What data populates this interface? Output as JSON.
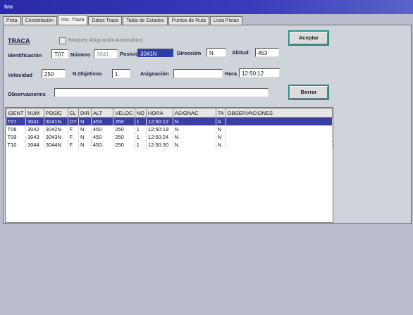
{
  "window": {
    "title": "tvu"
  },
  "tabs": [
    {
      "label": "Pista"
    },
    {
      "label": "Constelación"
    },
    {
      "label": "Inic. Traza"
    },
    {
      "label": "Datos Traza"
    },
    {
      "label": "Tabla de Estados"
    },
    {
      "label": "Puntos de Ruta"
    },
    {
      "label": "Lista Pistas"
    }
  ],
  "header": {
    "track_id": "TRACA",
    "auto_assign_label": "Bloqueo Asignación Automática"
  },
  "form": {
    "identificacion_label": "Identificación",
    "identificacion_value": "T07",
    "numero_label": "Número",
    "numero_value": "3041",
    "posicion_label": "Posición",
    "posicion_value": "3041N",
    "direccion_label": "Dirección",
    "direccion_value": "N",
    "altitud_label": "Altitud",
    "altitud_value": "453",
    "velocidad_label": "Velocidad",
    "velocidad_value": "250",
    "nobjetivos_label": "N.Objetivos",
    "nobjetivos_value": "1",
    "asignacion_label": "Asignación",
    "asignacion_value": "",
    "hora_label": "Hora",
    "hora_value": "12:50:12",
    "observaciones_label": "Observaciones",
    "observaciones_value": ""
  },
  "buttons": {
    "aceptar": "Aceptar",
    "borrar": "Borrar"
  },
  "table": {
    "columns": [
      "IDENT",
      "NUM",
      "POSIC",
      "CL",
      "DIR",
      "ALT",
      "VELOC",
      "NO",
      "HORA",
      "ASIGNAC",
      "TA",
      "OBSERVACIONES"
    ],
    "rows": [
      [
        "T07",
        "3041",
        "3041N",
        "DY",
        "N",
        "453",
        "250",
        "1",
        "12:50:12",
        "N",
        "A",
        ""
      ],
      [
        "T08",
        "3042",
        "3042N",
        "F",
        "N",
        "450",
        "250",
        "1",
        "12:50:18",
        "N",
        "N",
        ""
      ],
      [
        "T09",
        "3043",
        "3043N",
        "F",
        "N",
        "450",
        "250",
        "1",
        "12:50:24",
        "N",
        "N",
        ""
      ],
      [
        "T10",
        "3044",
        "3044N",
        "F",
        "N",
        "450",
        "250",
        "1",
        "12:50:30",
        "N",
        "N",
        ""
      ]
    ]
  }
}
